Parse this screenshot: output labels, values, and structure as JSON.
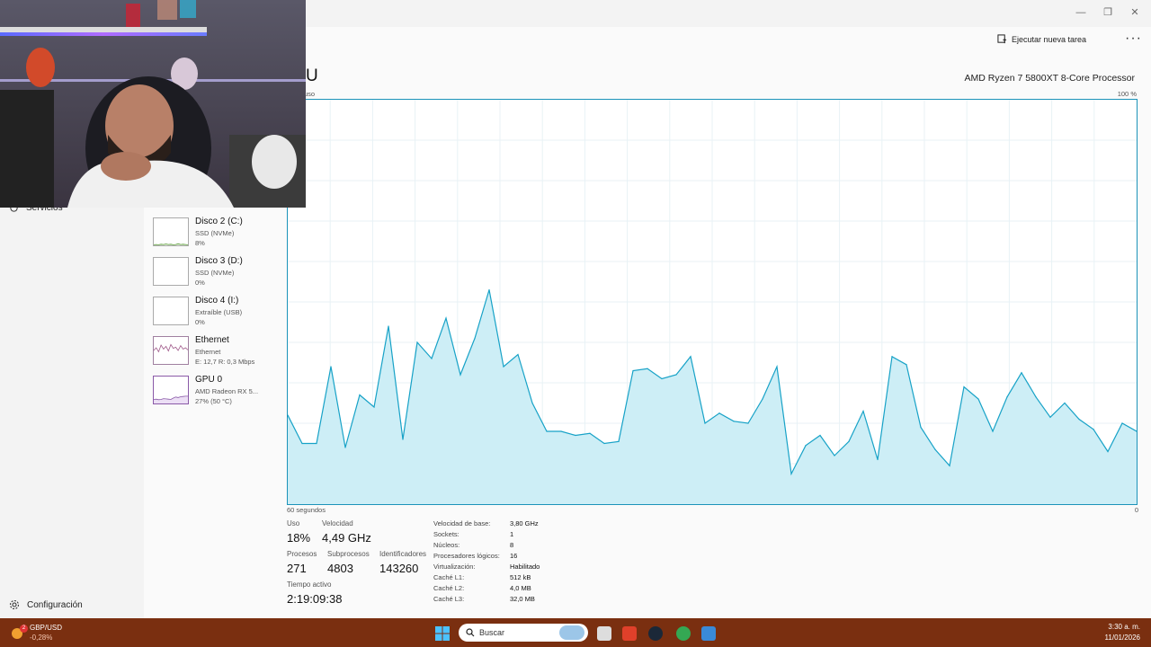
{
  "toolbar": {
    "run_task_label": "Ejecutar nueva tarea",
    "more_label": "···"
  },
  "sidebar": {
    "services_label": "Servicios",
    "settings_label": "Configuración"
  },
  "devices": [
    {
      "name": "Disco 2 (C:)",
      "type": "SSD (NVMe)",
      "detail": "8%"
    },
    {
      "name": "Disco 3 (D:)",
      "type": "SSD (NVMe)",
      "detail": "0%"
    },
    {
      "name": "Disco 4 (I:)",
      "type": "Extraíble (USB)",
      "detail": "0%"
    },
    {
      "name": "Ethernet",
      "type": "Ethernet",
      "detail": "E: 12,7 R: 0,3 Mbps"
    },
    {
      "name": "GPU 0",
      "type": "AMD Radeon RX 5...",
      "detail": "27% (50 °C)"
    }
  ],
  "cpu": {
    "title": "CPU",
    "title_visible": "U",
    "processor": "AMD Ryzen 7 5800XT 8-Core Processor",
    "usage_axis_label": "uso",
    "max_label": "100 %",
    "time_label": "60 segundos",
    "zero_label": "0",
    "stats": {
      "uso_label": "Uso",
      "uso": "18%",
      "velocidad_label": "Velocidad",
      "velocidad": "4,49 GHz",
      "procesos_label": "Procesos",
      "procesos": "271",
      "subprocesos_label": "Subprocesos",
      "subprocesos": "4803",
      "identificadores_label": "Identificadores",
      "identificadores": "143260",
      "tiempo_label": "Tiempo activo",
      "tiempo": "2:19:09:38"
    },
    "specs": [
      {
        "label": "Velocidad de base:",
        "value": "3,80 GHz"
      },
      {
        "label": "Sockets:",
        "value": "1"
      },
      {
        "label": "Núcleos:",
        "value": "8"
      },
      {
        "label": "Procesadores lógicos:",
        "value": "16"
      },
      {
        "label": "Virtualización:",
        "value": "Habilitado"
      },
      {
        "label": "Caché L1:",
        "value": "512 kB"
      },
      {
        "label": "Caché L2:",
        "value": "4,0 MB"
      },
      {
        "label": "Caché L3:",
        "value": "32,0 MB"
      }
    ]
  },
  "chart_data": {
    "type": "area",
    "x": [
      0,
      1,
      2,
      3,
      4,
      5,
      6,
      7,
      8,
      9,
      10,
      11,
      12,
      13,
      14,
      15,
      16,
      17,
      18,
      19,
      20,
      21,
      22,
      23,
      24,
      25,
      26,
      27,
      28,
      29,
      30,
      31,
      32,
      33,
      34,
      35,
      36,
      37,
      38,
      39,
      40,
      41,
      42,
      43,
      44,
      45,
      46,
      47,
      48,
      49,
      50,
      51,
      52,
      53,
      54,
      55,
      56,
      57,
      58,
      59
    ],
    "values": [
      22,
      15,
      15,
      34,
      14,
      27,
      24,
      44,
      16,
      40,
      36,
      46,
      32,
      41,
      53,
      34,
      37,
      25,
      18,
      18,
      17,
      17.5,
      15,
      15.5,
      33,
      33.5,
      31,
      32,
      36.5,
      20,
      22.5,
      20.5,
      20,
      26,
      34,
      7.5,
      14.5,
      17,
      12,
      15.5,
      23,
      11,
      36.5,
      34.5,
      19,
      13.5,
      9.5,
      29,
      26,
      18,
      26.5,
      32.5,
      26.5,
      21.5,
      25,
      21,
      18.5,
      13,
      20,
      18
    ],
    "ylim": [
      0,
      100
    ],
    "xlim": [
      0,
      59
    ],
    "xlabel": "60 segundos",
    "ymax_label": "100 %",
    "color": "#17a2c7",
    "fill": "#cdeef6",
    "grid": true
  },
  "thumbs": {
    "disk2": [
      2,
      3,
      2,
      4,
      3,
      5,
      3,
      4,
      2,
      3,
      6,
      3,
      4,
      3,
      2
    ],
    "ethernet": [
      50,
      60,
      45,
      70,
      55,
      65,
      48,
      72,
      58,
      62,
      50,
      68,
      55,
      60,
      52
    ],
    "gpu": [
      15,
      16,
      14,
      15,
      18,
      17,
      16,
      15,
      20,
      24,
      22,
      25,
      26,
      27,
      27
    ]
  },
  "taskbar": {
    "ticker_label": "GBP/USD",
    "ticker_change": "-0,28%",
    "badge": "2",
    "search_placeholder": "Buscar",
    "time": "3:30 a. m.",
    "date": "11/01/2026"
  }
}
